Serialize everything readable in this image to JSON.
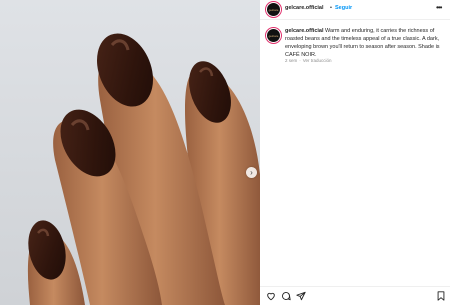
{
  "post": {
    "username": "gelcare.official",
    "separator": "•",
    "follow_label": "Seguir",
    "more_label": "•••",
    "avatar_text": "gelcare",
    "caption_user": "gelcare.official",
    "caption_text": " Warm and enduring, it carries the richness of roasted beans and the timeless appeal of a true classic. A dark, enveloping brown you'll return to season after season. Shade is CAFÉ NOIR.",
    "time_ago": "2 sem",
    "meta_separator": "·",
    "translate_label": "Ver traducción",
    "next_label": "›"
  },
  "colors": {
    "follow_blue": "#0095f6",
    "nail_brown": "#3a1d14",
    "skin": "#b57a52"
  },
  "icons": [
    "heart-icon",
    "comment-icon",
    "share-icon",
    "bookmark-icon",
    "chevron-right-icon"
  ]
}
